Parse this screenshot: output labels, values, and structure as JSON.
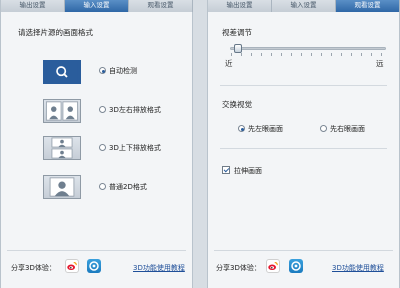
{
  "left_panel": {
    "tabs": [
      "输出设置",
      "输入设置",
      "观看设置"
    ],
    "active_tab": 1,
    "heading": "请选择片源的画面格式",
    "options": [
      {
        "label": "自动检测",
        "icon": "magnifier-icon",
        "selected": true
      },
      {
        "label": "3D左右排放格式",
        "icon": "side-by-side-icon",
        "selected": false
      },
      {
        "label": "3D上下排放格式",
        "icon": "top-bottom-icon",
        "selected": false
      },
      {
        "label": "普通2D格式",
        "icon": "single-person-icon",
        "selected": false
      }
    ],
    "footer": {
      "share_label": "分享3D体验：",
      "help_link": "3D功能使用教程"
    }
  },
  "right_panel": {
    "tabs": [
      "输出设置",
      "输入设置",
      "观看设置"
    ],
    "active_tab": 2,
    "parallax": {
      "heading": "视差调节",
      "near_label": "近",
      "far_label": "远",
      "value_fraction": 0.05
    },
    "swap": {
      "heading": "交换视觉",
      "left_first": "先左眼画面",
      "right_first": "先右眼画面",
      "selected": "left_first"
    },
    "stretch": {
      "label": "拉伸画面",
      "checked": true
    },
    "footer": {
      "share_label": "分享3D体验：",
      "help_link": "3D功能使用教程"
    }
  },
  "colors": {
    "accent": "#2a5d9c",
    "link": "#1f4f99"
  }
}
